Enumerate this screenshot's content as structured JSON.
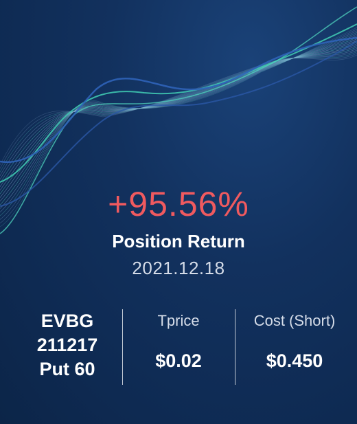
{
  "position": {
    "return_pct": "+95.56%",
    "return_label": "Position Return",
    "date": "2021.12.18"
  },
  "contract": {
    "symbol": "EVBG",
    "expiry": "211217",
    "type_strike": "Put 60"
  },
  "tprice": {
    "label": "Tprice",
    "value": "$0.02"
  },
  "cost": {
    "label": "Cost (Short)",
    "value": "$0.450"
  },
  "colors": {
    "return_positive": "#f05a5f",
    "background": "#0f2a52",
    "wave_teal": "#3fc7b0",
    "wave_blue": "#2f63b8"
  }
}
